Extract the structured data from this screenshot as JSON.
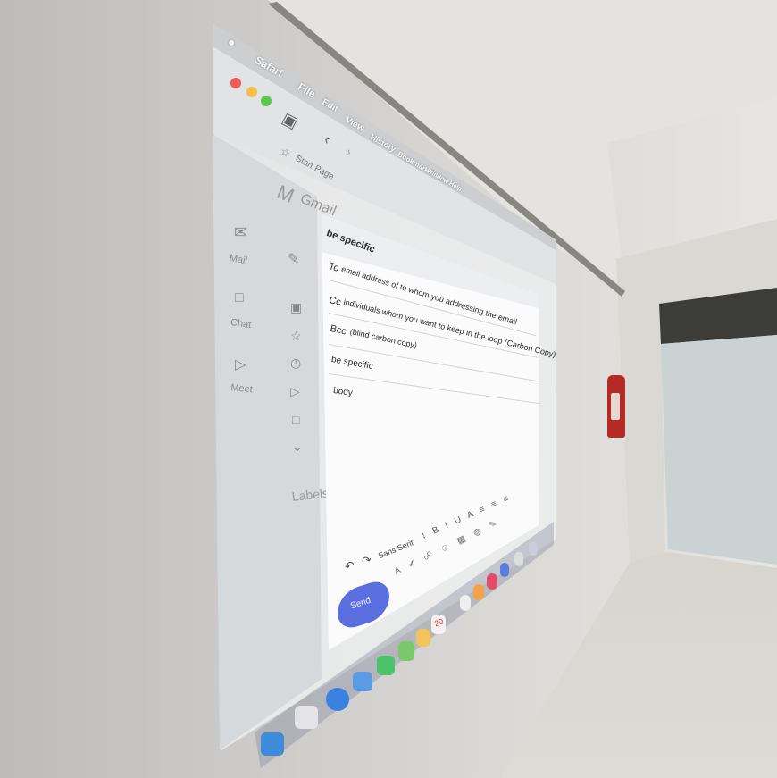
{
  "menubar": {
    "apple_icon": "apple-logo-icon",
    "items": [
      "Safari",
      "File",
      "Edit",
      "View",
      "History",
      "Bookmarks",
      "Window",
      "Help"
    ]
  },
  "browser": {
    "start_page": "Start Page",
    "traffic_lights": [
      "#ef5b55",
      "#f4bd4f",
      "#5fc453"
    ]
  },
  "gmail": {
    "logo_text": "Gmail",
    "nav": [
      "Mail",
      "Chat",
      "Meet"
    ],
    "labels_heading": "Labels"
  },
  "compose": {
    "subject_header": "be specific",
    "to_label": "To",
    "to_value": "email address of to whom you addressing the email",
    "cc_label": "Cc",
    "cc_value": "individuals whom you want to keep in the loop (Carbon Copy)",
    "bcc_label": "Bcc",
    "bcc_value": "(blind carbon copy)",
    "subject_value": "be specific",
    "body": "body",
    "font_name": "Sans Serif",
    "send_label": "Send"
  },
  "dock": {
    "calendar_day": "20"
  },
  "colors": {
    "accent": "#5b6ee0",
    "extinguisher": "#b52a24"
  }
}
